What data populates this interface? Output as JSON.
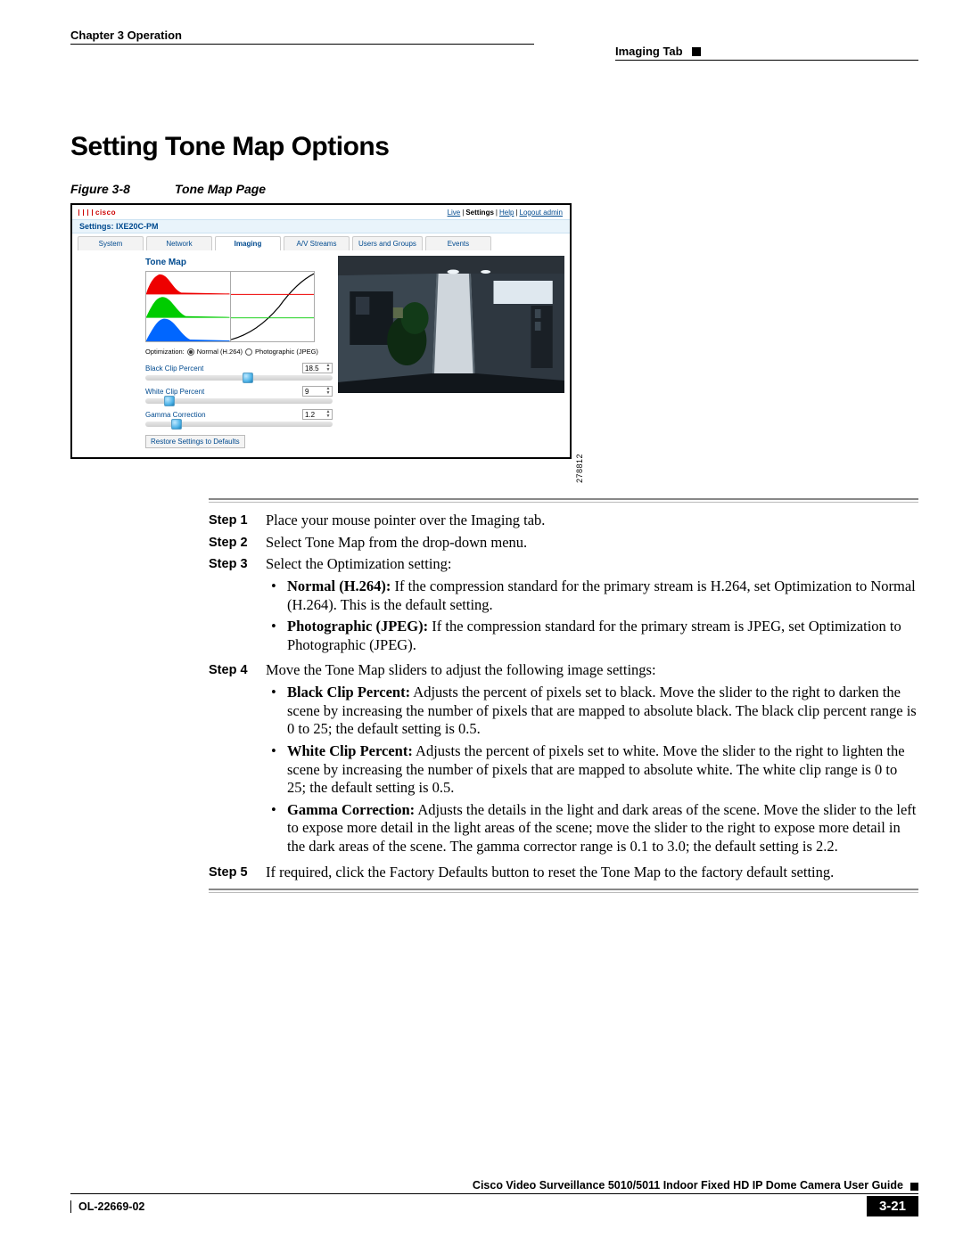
{
  "header": {
    "chapter": "Chapter 3    Operation",
    "tab": "Imaging Tab"
  },
  "heading": "Setting Tone Map Options",
  "figure": {
    "label": "Figure 3-8",
    "title": "Tone Map Page",
    "id": "278812",
    "nav": {
      "live": "Live",
      "settings": "Settings",
      "help": "Help",
      "logout": "Logout admin"
    },
    "settings_label": "Settings: IXE20C-PM",
    "tabs": [
      "System",
      "Network",
      "Imaging",
      "A/V Streams",
      "Users and Groups",
      "Events"
    ],
    "active_tab": 2,
    "panel_title": "Tone Map",
    "optimization": {
      "label": "Optimization:",
      "opt_normal": "Normal (H.264)",
      "opt_photo": "Photographic (JPEG)",
      "selected": "normal"
    },
    "sliders": {
      "black": {
        "label": "Black Clip Percent",
        "value": "18.5",
        "pos": 52
      },
      "white": {
        "label": "White Clip Percent",
        "value": "9",
        "pos": 10
      },
      "gamma": {
        "label": "Gamma Correction",
        "value": "1.2",
        "pos": 14
      }
    },
    "defaults_btn": "Restore Settings to Defaults"
  },
  "steps": {
    "s1_label": "Step 1",
    "s1_text": "Place your mouse pointer over the Imaging tab.",
    "s2_label": "Step 2",
    "s2_text": "Select Tone Map from the drop-down menu.",
    "s3_label": "Step 3",
    "s3_text": "Select the Optimization setting:",
    "s3_b1_term": "Normal (H.264):",
    "s3_b1_rest": " If the compression standard for the primary stream is H.264, set Optimization to Normal (H.264). This is the default setting.",
    "s3_b2_term": "Photographic (JPEG):",
    "s3_b2_rest": " If the compression standard for the primary stream is JPEG, set Optimization to Photographic (JPEG).",
    "s4_label": "Step 4",
    "s4_text": "Move the Tone Map sliders to adjust the following image settings:",
    "s4_b1_term": "Black Clip Percent:",
    "s4_b1_rest": " Adjusts the percent of pixels set to black. Move the slider to the right to darken the scene by increasing the number of pixels that are mapped to absolute black. The black clip percent range is 0 to 25; the default setting is 0.5.",
    "s4_b2_term": "White Clip Percent:",
    "s4_b2_rest": " Adjusts the percent of pixels set to white. Move the slider to the right to lighten the scene by increasing the number of pixels that are mapped to absolute white. The white clip range is 0 to 25; the default setting is 0.5.",
    "s4_b3_term": "Gamma Correction:",
    "s4_b3_rest": " Adjusts the details in the light and dark areas of the scene. Move the slider to the left to expose more detail in the light areas of the scene; move the slider to the right to expose more detail in the dark areas of the scene. The gamma corrector range is 0.1 to 3.0; the default setting is 2.2.",
    "s5_label": "Step 5",
    "s5_text": "If required, click the Factory Defaults button to reset the Tone Map to the factory default setting."
  },
  "footer": {
    "guide": "Cisco Video Surveillance 5010/5011 Indoor Fixed HD IP Dome Camera User Guide",
    "ol": "OL-22669-02",
    "page": "3-21"
  }
}
